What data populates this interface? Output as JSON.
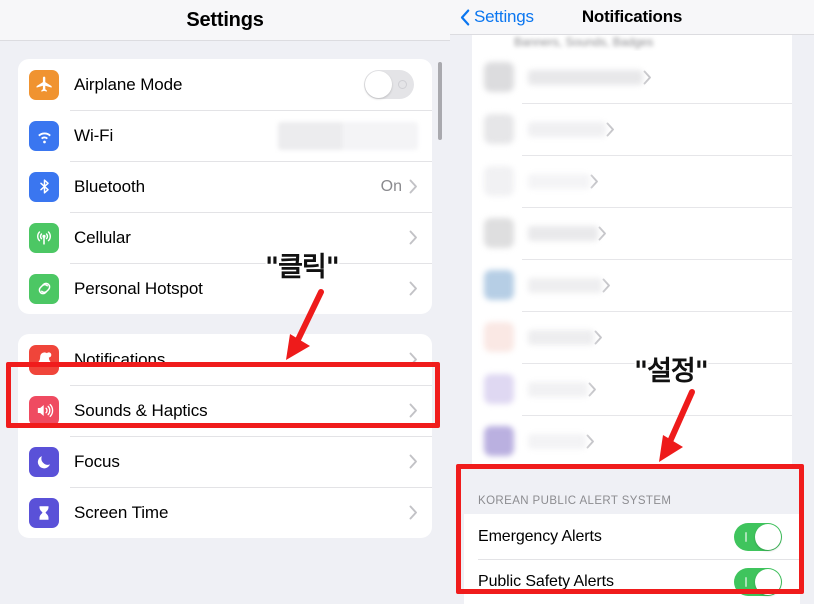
{
  "left_panel": {
    "header_title": "Settings",
    "group1": [
      {
        "label": "Airplane Mode",
        "icon": "airplane-icon",
        "icon_color": "#f09330",
        "control": "toggle-off",
        "value": ""
      },
      {
        "label": "Wi-Fi",
        "icon": "wifi-icon",
        "icon_color": "#3a76f0",
        "control": "redacted",
        "value": ""
      },
      {
        "label": "Bluetooth",
        "icon": "bluetooth-icon",
        "icon_color": "#3a76f0",
        "control": "chevron",
        "value": "On"
      },
      {
        "label": "Cellular",
        "icon": "cellular-icon",
        "icon_color": "#4cc764",
        "control": "chevron",
        "value": ""
      },
      {
        "label": "Personal Hotspot",
        "icon": "hotspot-icon",
        "icon_color": "#4cc764",
        "control": "chevron",
        "value": ""
      }
    ],
    "group2": [
      {
        "label": "Notifications",
        "icon": "bell-icon",
        "icon_color": "#f0453a",
        "control": "chevron",
        "value": ""
      },
      {
        "label": "Sounds & Haptics",
        "icon": "speaker-icon",
        "icon_color": "#ef4b61",
        "control": "chevron",
        "value": ""
      },
      {
        "label": "Focus",
        "icon": "moon-icon",
        "icon_color": "#5a51d8",
        "control": "chevron",
        "value": ""
      },
      {
        "label": "Screen Time",
        "icon": "hourglass-icon",
        "icon_color": "#5a51d8",
        "control": "chevron",
        "value": ""
      }
    ]
  },
  "right_panel": {
    "back_label": "Settings",
    "header_title": "Notifications",
    "cut_off_text": "Banners, Sounds, Badges",
    "blurred_rows": [
      {
        "label": "",
        "redacted": true
      },
      {
        "label": "",
        "redacted": true
      },
      {
        "label": "",
        "redacted": true
      },
      {
        "label": "",
        "redacted": true
      },
      {
        "label": "",
        "redacted": true
      },
      {
        "label": "",
        "redacted": true
      },
      {
        "label": "",
        "redacted": true
      }
    ],
    "alert_section": {
      "header": "KOREAN PUBLIC ALERT SYSTEM",
      "rows": [
        {
          "label": "Emergency Alerts",
          "toggle": "on"
        },
        {
          "label": "Public Safety Alerts",
          "toggle": "on"
        }
      ]
    }
  },
  "annotations": {
    "click_label": "\"클릭\"",
    "settings_label": "\"설정\"",
    "highlight_color": "#f01c1c",
    "arrow_color": "#ee1b1b"
  }
}
